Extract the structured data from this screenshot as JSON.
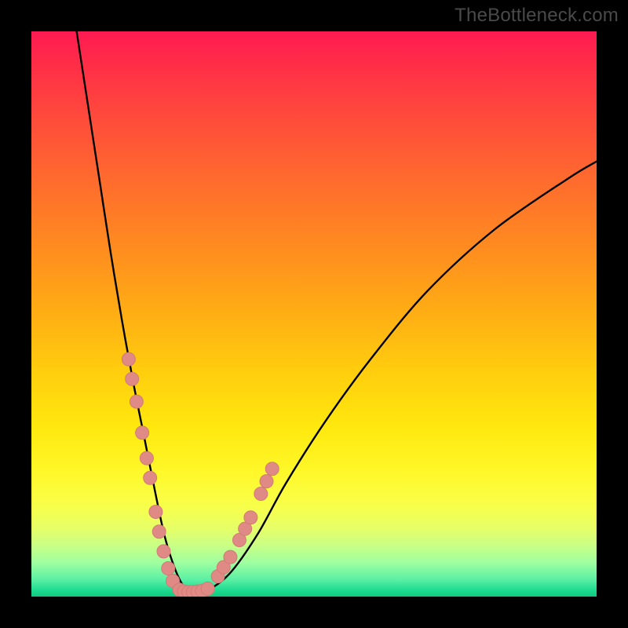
{
  "attribution": "TheBottleneck.com",
  "colors": {
    "frame": "#000000",
    "curve": "#000000",
    "marker_fill": "#e08a86",
    "marker_stroke": "#d37a76",
    "gradient_top": "#ff1a52",
    "gradient_mid": "#ffe80e",
    "gradient_bottom": "#12c77e"
  },
  "chart_data": {
    "type": "line",
    "title": "",
    "xlabel": "",
    "ylabel": "",
    "xlim": [
      0,
      100
    ],
    "ylim": [
      0,
      100
    ],
    "grid": false,
    "legend": false,
    "note": "Axes are unlabeled in the source image; values are estimated as percentages of plot width/height read from the figure.",
    "series": [
      {
        "name": "curve",
        "kind": "line",
        "x": [
          8,
          10,
          12,
          14,
          16,
          18,
          20,
          22,
          23.5,
          25,
          26.5,
          28,
          30.5,
          35,
          40,
          45,
          52,
          60,
          70,
          82,
          95,
          100
        ],
        "y": [
          100,
          87,
          74,
          61,
          49,
          38,
          28,
          18,
          11,
          6,
          2.5,
          0.8,
          0.8,
          4,
          11,
          20,
          31,
          42,
          54,
          65,
          74,
          77
        ]
      },
      {
        "name": "markers-left",
        "kind": "scatter",
        "x": [
          17.2,
          17.8,
          18.6,
          19.6,
          20.4,
          21.0,
          22.0,
          22.6,
          23.4,
          24.2,
          25.0
        ],
        "y": [
          42.0,
          38.5,
          34.5,
          29.0,
          24.5,
          21.0,
          15.0,
          11.5,
          8.0,
          5.0,
          2.8
        ]
      },
      {
        "name": "markers-valley",
        "kind": "scatter",
        "x": [
          26.2,
          27.0,
          27.8,
          28.6,
          29.4,
          30.2,
          31.2
        ],
        "y": [
          1.2,
          0.9,
          0.8,
          0.8,
          0.9,
          1.0,
          1.4
        ]
      },
      {
        "name": "markers-right",
        "kind": "scatter",
        "x": [
          33.0,
          34.0,
          35.2,
          36.8,
          37.8,
          38.8,
          40.6,
          41.6,
          42.6
        ],
        "y": [
          3.6,
          5.2,
          7.0,
          10.0,
          12.0,
          14.0,
          18.2,
          20.4,
          22.6
        ]
      }
    ]
  }
}
